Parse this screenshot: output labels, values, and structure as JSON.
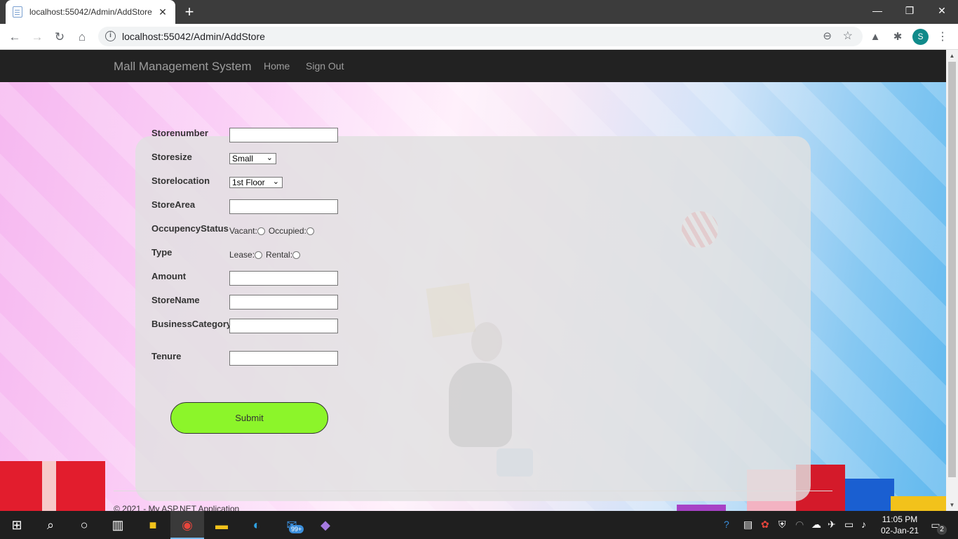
{
  "browser": {
    "tab_title": "localhost:55042/Admin/AddStore",
    "tab_close": "✕",
    "new_tab": "+",
    "url": "localhost:55042/Admin/AddStore",
    "profile_initial": "S",
    "icons": [
      "back-icon",
      "forward-icon",
      "reload-icon",
      "home-icon",
      "info-icon",
      "zoom-icon",
      "star-icon",
      "drive-icon",
      "extensions-icon",
      "menu-icon"
    ]
  },
  "window_controls": {
    "minimize": "—",
    "restore": "❐",
    "close": "✕"
  },
  "navbar": {
    "brand": "Mall Management System",
    "links": [
      "Home",
      "Sign Out"
    ]
  },
  "form": {
    "fields": {
      "storenumber": {
        "label": "Storenumber",
        "value": ""
      },
      "storesize": {
        "label": "Storesize",
        "selected": "Small"
      },
      "storelocation": {
        "label": "Storelocation",
        "selected": "1st Floor"
      },
      "storearea": {
        "label": "StoreArea",
        "value": ""
      },
      "occupancy": {
        "label": "OccupencyStatus",
        "options": [
          "Vacant:",
          "Occupied:"
        ]
      },
      "type": {
        "label": "Type",
        "options": [
          "Lease:",
          "Rental:"
        ]
      },
      "amount": {
        "label": "Amount",
        "value": ""
      },
      "storename": {
        "label": "StoreName",
        "value": ""
      },
      "businesscategory": {
        "label": "BusinessCategory",
        "value": ""
      },
      "tenure": {
        "label": "Tenure",
        "value": ""
      }
    },
    "submit_label": "Submit"
  },
  "footer": {
    "text": "© 2021 - My ASP.NET Application"
  },
  "taskbar": {
    "clock_time": "11:05 PM",
    "clock_date": "02-Jan-21",
    "mail_badge": "99+",
    "notification_count": "2"
  },
  "colors": {
    "navbar_bg": "#222222",
    "submit_bg": "#8cf52a",
    "panel_bg": "#e1e1e1"
  }
}
